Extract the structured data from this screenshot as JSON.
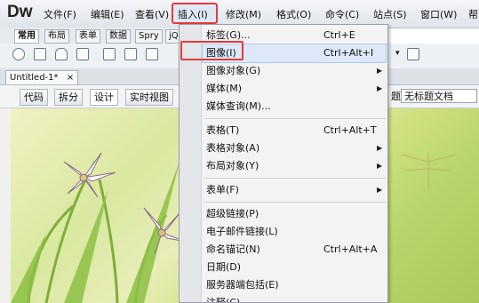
{
  "app": {
    "logo": "Dw"
  },
  "menu": [
    {
      "id": "file",
      "label": "文件(F)"
    },
    {
      "id": "edit",
      "label": "编辑(E)"
    },
    {
      "id": "view",
      "label": "查看(V)"
    },
    {
      "id": "insert",
      "label": "插入(I)"
    },
    {
      "id": "modify",
      "label": "修改(M)"
    },
    {
      "id": "format",
      "label": "格式(O)"
    },
    {
      "id": "commands",
      "label": "命令(C)"
    },
    {
      "id": "site",
      "label": "站点(S)"
    },
    {
      "id": "window",
      "label": "窗口(W)"
    },
    {
      "id": "help",
      "label": "帮"
    }
  ],
  "insert_tabs": [
    "常用",
    "布局",
    "表单",
    "数据",
    "Spry",
    "jQ"
  ],
  "document": {
    "tab_label": "Untitled-1*",
    "close_glyph": "×"
  },
  "view_buttons": [
    "代码",
    "拆分",
    "设计",
    "实时视图"
  ],
  "title_field": {
    "label": "题:",
    "value": "无标题文档"
  },
  "insert_menu": {
    "items": [
      {
        "label": "标签(G)...",
        "shortcut": "Ctrl+E",
        "submenu": false
      },
      {
        "label": "图像(I)",
        "shortcut": "Ctrl+Alt+I",
        "submenu": false
      },
      {
        "label": "图像对象(G)",
        "shortcut": "",
        "submenu": true
      },
      {
        "label": "媒体(M)",
        "shortcut": "",
        "submenu": true
      },
      {
        "label": "媒体查询(M)...",
        "shortcut": "",
        "submenu": false
      },
      {
        "label": "表格(T)",
        "shortcut": "Ctrl+Alt+T",
        "submenu": false
      },
      {
        "label": "表格对象(A)",
        "shortcut": "",
        "submenu": true
      },
      {
        "label": "布局对象(Y)",
        "shortcut": "",
        "submenu": true
      },
      {
        "label": "表单(F)",
        "shortcut": "",
        "submenu": true
      },
      {
        "label": "超级链接(P)",
        "shortcut": "",
        "submenu": false
      },
      {
        "label": "电子邮件链接(L)",
        "shortcut": "",
        "submenu": false
      },
      {
        "label": "命名锚记(N)",
        "shortcut": "Ctrl+Alt+A",
        "submenu": false
      },
      {
        "label": "日期(D)",
        "shortcut": "",
        "submenu": false
      },
      {
        "label": "服务器端包括(E)",
        "shortcut": "",
        "submenu": false
      },
      {
        "label": "注释(C)",
        "shortcut": "",
        "submenu": false
      }
    ],
    "submenu_glyph": "▶"
  },
  "colors": {
    "highlight_red": "#e53a3a",
    "annotation_arrow": "#e53a3a"
  }
}
